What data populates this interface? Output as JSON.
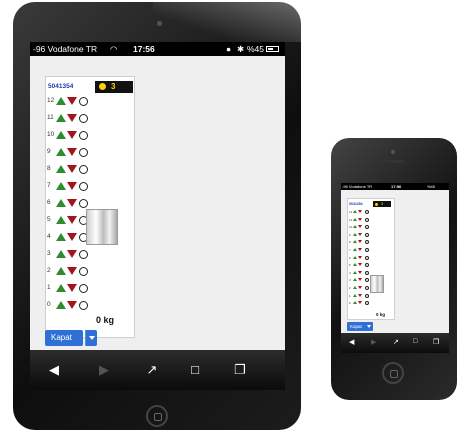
{
  "tablet": {
    "status_bar": {
      "carrier": "-96 Vodafone TR",
      "time": "17:56",
      "battery": "%45"
    },
    "panel": {
      "elevator_code": "5041354",
      "count_badge": "3",
      "floors": [
        "12",
        "11",
        "10",
        "9",
        "8",
        "7",
        "6",
        "5",
        "4",
        "3",
        "2",
        "1",
        "0"
      ],
      "load": "0 kg"
    },
    "close_button": "Kapat",
    "toolbar_icons": [
      "back-icon",
      "forward-icon",
      "share-icon",
      "bookmarks-icon",
      "tabs-icon"
    ]
  },
  "phone": {
    "status_bar": {
      "carrier": "-96 Vodafone TR",
      "time": "17:56",
      "battery": "%45"
    },
    "panel": {
      "elevator_code": "5041354",
      "count_badge": "3",
      "load": "0 kg"
    },
    "close_button": "Kapat"
  },
  "colors": {
    "up_arrow": "#2e8b2e",
    "down_arrow": "#a3141b",
    "button_blue": "#2f6fd6",
    "badge_text": "#ffd100"
  }
}
